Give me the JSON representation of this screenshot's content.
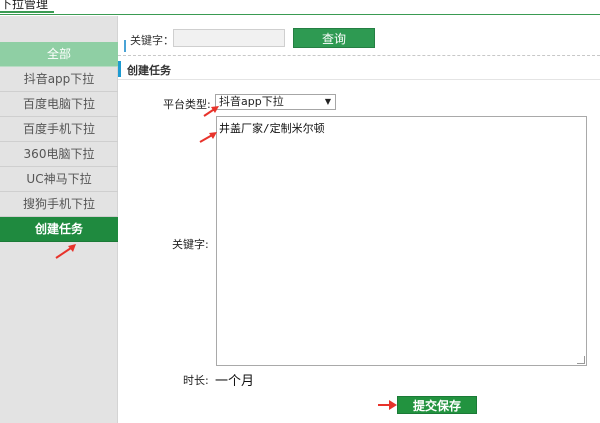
{
  "header": {
    "tab_label": "下拉管理"
  },
  "sidebar": {
    "items": [
      {
        "label": "全部"
      },
      {
        "label": "抖音app下拉"
      },
      {
        "label": "百度电脑下拉"
      },
      {
        "label": "百度手机下拉"
      },
      {
        "label": "360电脑下拉"
      },
      {
        "label": "UC神马下拉"
      },
      {
        "label": "搜狗手机下拉"
      },
      {
        "label": "创建任务"
      }
    ]
  },
  "search": {
    "label": "关键字：",
    "value": "",
    "button_label": "查询"
  },
  "section": {
    "title": "创建任务"
  },
  "form": {
    "platform_label": "平台类型:",
    "platform_value": "抖音app下拉",
    "keyword_label": "关键字:",
    "keyword_value": "井盖厂家/定制米尔顿",
    "duration_label": "时长:",
    "duration_value": "一个月",
    "submit_label": "提交保存"
  },
  "colors": {
    "accent_green": "#22933f",
    "annotation_red": "#e8332b"
  }
}
